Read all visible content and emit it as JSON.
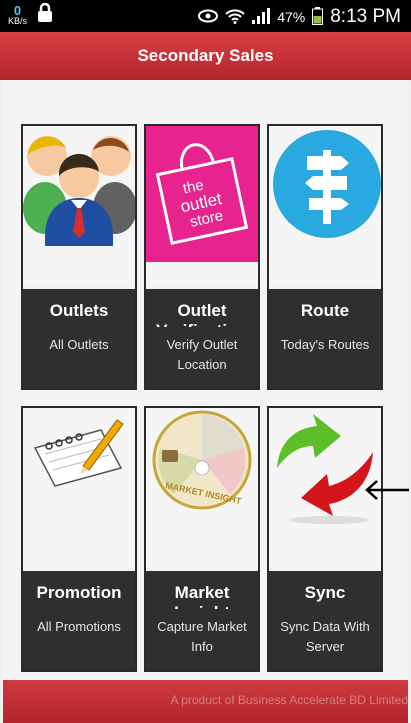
{
  "status_bar": {
    "data_rate": "0",
    "data_unit": "KB/s",
    "battery": "47%",
    "time": "8:13 PM"
  },
  "app_bar": {
    "title": "Secondary Sales"
  },
  "tiles": [
    {
      "title": "Outlets",
      "subtitle": "All Outlets"
    },
    {
      "title": "Outlet Verification",
      "subtitle": "Verify Outlet Location"
    },
    {
      "title": "Route",
      "subtitle": "Today's Routes"
    },
    {
      "title": "Promotion",
      "subtitle": "All Promotions"
    },
    {
      "title": "Market Insight",
      "subtitle": "Capture Market Info"
    },
    {
      "title": "Sync",
      "subtitle": "Sync Data With Server"
    }
  ],
  "images": {
    "outlet_store_text": [
      "the",
      "outlet",
      "store"
    ],
    "market_insight_text": "MARKET INSIGHT"
  },
  "footer": {
    "text": "A product of Business Accelerate BD Limited"
  },
  "colors": {
    "accent": "#c0282e",
    "panel": "#2f2f2f"
  }
}
